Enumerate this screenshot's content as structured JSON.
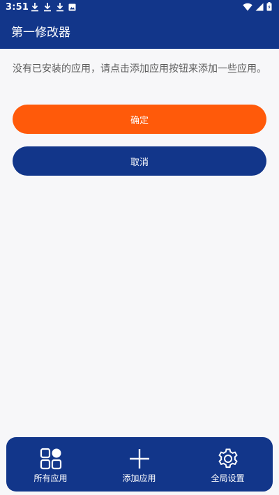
{
  "status_bar": {
    "time": "3:51",
    "left_icons": [
      "download-icon",
      "download-icon",
      "download-icon",
      "image-notification-icon"
    ],
    "right_icons": [
      "wifi-icon",
      "signal-icon",
      "battery-icon"
    ]
  },
  "app_bar": {
    "title": "第一修改器"
  },
  "main": {
    "message": "没有已安装的应用，请点击添加应用按钮来添加一些应用。",
    "confirm_label": "确定",
    "cancel_label": "取消"
  },
  "bottom_nav": {
    "items": [
      {
        "label": "所有应用",
        "icon": "apps-grid-icon"
      },
      {
        "label": "添加应用",
        "icon": "plus-icon"
      },
      {
        "label": "全局设置",
        "icon": "gear-icon"
      }
    ]
  },
  "colors": {
    "primary": "#12368a",
    "accent": "#ff5a0a",
    "background": "#f7f7f9",
    "message_text": "#5d5d5d"
  }
}
